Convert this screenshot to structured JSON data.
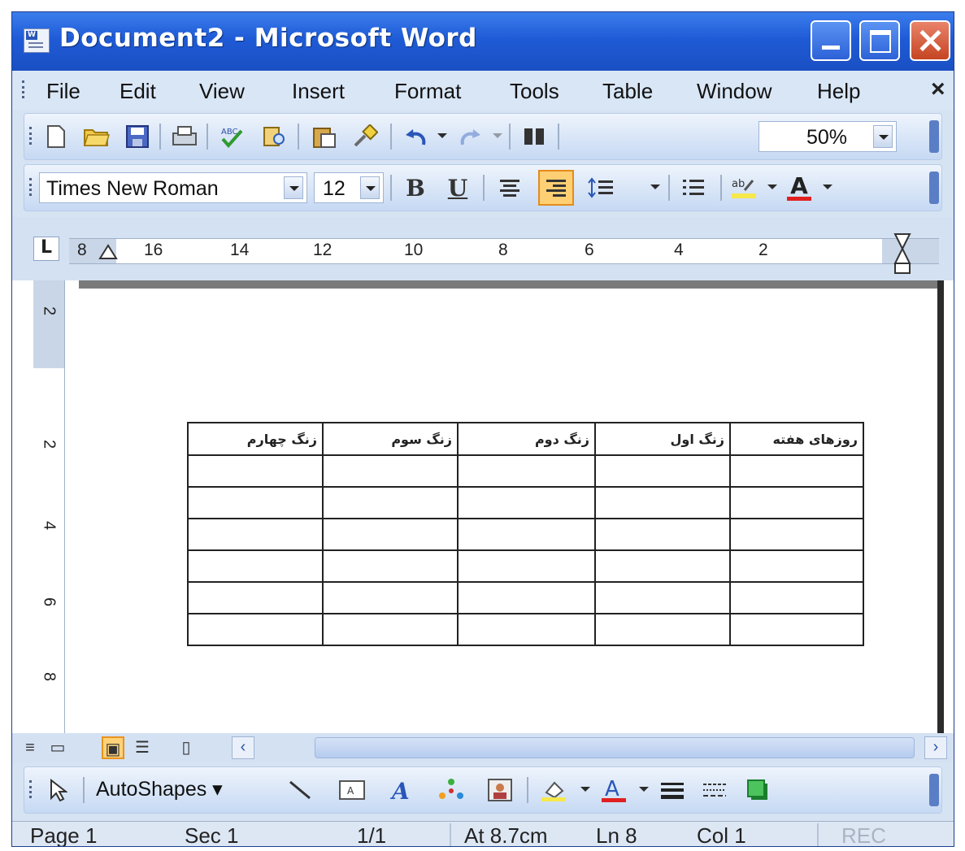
{
  "window": {
    "title": "Document2 - Microsoft Word",
    "app_icon": "word-document-icon",
    "controls": [
      "minimize-icon",
      "maximize-icon",
      "close-icon"
    ]
  },
  "menu": {
    "items": [
      "File",
      "Edit",
      "View",
      "Insert",
      "Format",
      "Tools",
      "Table",
      "Window",
      "Help"
    ],
    "close_glyph": "×"
  },
  "standard_toolbar": {
    "icons": [
      "new-document-icon",
      "open-folder-icon",
      "save-icon",
      "print-icon",
      "spelling-grammar-icon",
      "research-icon",
      "paste-icon",
      "format-painter-icon",
      "undo-icon",
      "redo-icon",
      "columns-icon"
    ],
    "zoom": "50%"
  },
  "format_toolbar": {
    "font": "Times New Roman",
    "size": "12",
    "bold": "B",
    "underline": "U",
    "align_center_icon": "align-center-icon",
    "align_right_icon": "align-right-icon",
    "line_spacing_icon": "line-spacing-icon",
    "numbering_icon": "numbering-icon",
    "highlight_icon": "highlight-icon",
    "font_color_label": "A"
  },
  "ruler": {
    "tab_selector": "L",
    "labels": [
      "8",
      "16",
      "14",
      "12",
      "10",
      "8",
      "6",
      "4",
      "2"
    ],
    "vertical_labels": [
      "2",
      "2",
      "4",
      "6",
      "8"
    ]
  },
  "table": {
    "headers": [
      "روزهای هفته",
      "زنگ اول",
      "زنگ دوم",
      "زنگ سوم",
      "زنگ چهارم"
    ],
    "empty_rows": 6
  },
  "view_buttons": [
    "normal-view-icon",
    "web-layout-icon",
    "print-layout-icon",
    "outline-view-icon",
    "reading-layout-icon"
  ],
  "drawing_toolbar": {
    "autoshapes": "AutoShapes ▾",
    "icons": [
      "select-pointer-icon",
      "line-icon",
      "textbox-icon",
      "wordart-icon",
      "diagram-icon",
      "picture-icon",
      "fill-color-icon",
      "font-color-icon",
      "line-style-icon",
      "dash-style-icon",
      "shadow-icon"
    ]
  },
  "status": {
    "page": "Page 1",
    "sec": "Sec 1",
    "pages": "1/1",
    "at": "At 8.7cm",
    "ln": "Ln 8",
    "col": "Col 1",
    "rec": "REC"
  },
  "colors": {
    "titlebar": "#1f5bd6",
    "highlight_yellow": "#f7e84b",
    "font_red": "#e02020"
  }
}
